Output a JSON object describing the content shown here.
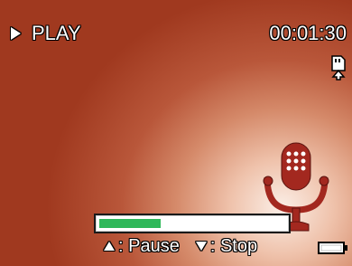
{
  "mode": {
    "label": "PLAY",
    "icon": "play-icon"
  },
  "timer": {
    "value": "00:01:30"
  },
  "storage": {
    "icon": "sd-card-icon"
  },
  "media": {
    "icon": "microphone-icon"
  },
  "playback": {
    "progress_fraction": 0.33
  },
  "controls": [
    {
      "icon": "up-arrow-icon",
      "label": ": Pause"
    },
    {
      "icon": "down-arrow-icon",
      "label": ": Stop"
    }
  ],
  "battery": {
    "icon": "battery-icon"
  },
  "colors": {
    "accent_progress": "#2fb85a",
    "mic": "#a3281f",
    "background_dark": "#a0391f",
    "background_light": "#fbeee6"
  }
}
